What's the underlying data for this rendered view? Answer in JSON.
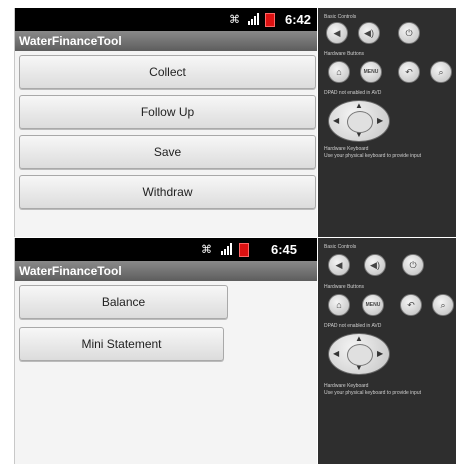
{
  "screen1": {
    "status_time": "6:42",
    "app_title": "WaterFinanceTool",
    "buttons": [
      "Collect",
      "Follow Up",
      "Save",
      "Withdraw"
    ]
  },
  "screen2": {
    "status_time": "6:45",
    "app_title": "WaterFinanceTool",
    "buttons": [
      "Balance",
      "Mini Statement"
    ]
  },
  "controls": {
    "basic_controls": "Basic Controls",
    "hardware_buttons": "Hardware Buttons",
    "dpad": "DPAD not enabled in AVD",
    "keyboard": "Hardware Keyboard",
    "keyboard_hint": "Use your physical keyboard to provide input",
    "menu_label": "MENU"
  },
  "colors": {
    "status_bar": "#000000",
    "title_bar": "#6e6e6e",
    "battery": "#dd1111",
    "panel": "#2e2e2e"
  }
}
